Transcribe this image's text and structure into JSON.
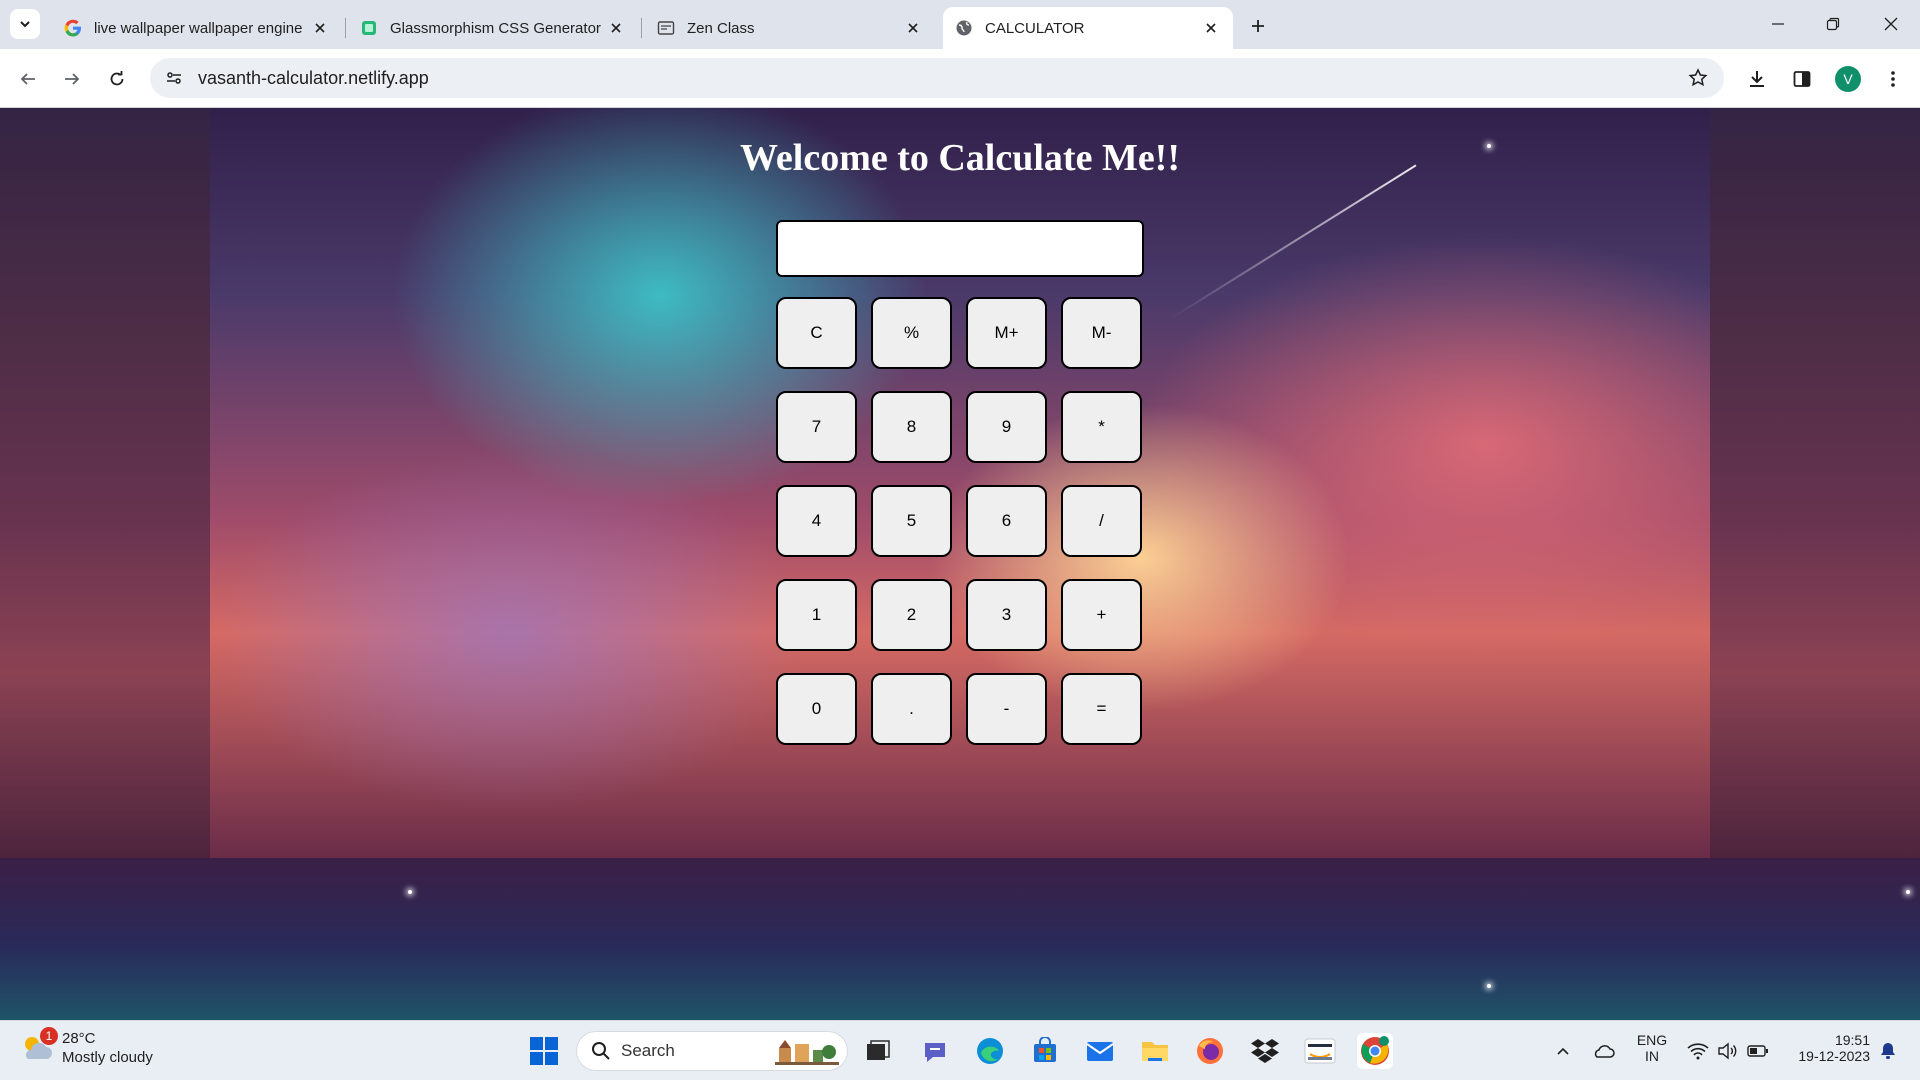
{
  "browser": {
    "tabs": [
      {
        "title": "live wallpaper wallpaper engine",
        "icon": "google-icon"
      },
      {
        "title": "Glassmorphism CSS Generator",
        "icon": "css-generator-icon"
      },
      {
        "title": "Zen Class",
        "icon": "zen-class-icon"
      },
      {
        "title": "CALCULATOR",
        "icon": "globe-icon",
        "active": true
      }
    ],
    "url": "vasanth-calculator.netlify.app",
    "profile_initial": "V"
  },
  "page": {
    "heading": "Welcome to Calculate Me!!",
    "display_value": "",
    "keys": [
      [
        "C",
        "%",
        "M+",
        "M-"
      ],
      [
        "7",
        "8",
        "9",
        "*"
      ],
      [
        "4",
        "5",
        "6",
        "/"
      ],
      [
        "1",
        "2",
        "3",
        "+"
      ],
      [
        "0",
        ".",
        "-",
        "="
      ]
    ]
  },
  "taskbar": {
    "weather_temp": "28°C",
    "weather_desc": "Mostly cloudy",
    "weather_badge": "1",
    "search_label": "Search",
    "lang_line1": "ENG",
    "lang_line2": "IN",
    "time": "19:51",
    "date": "19-12-2023"
  }
}
